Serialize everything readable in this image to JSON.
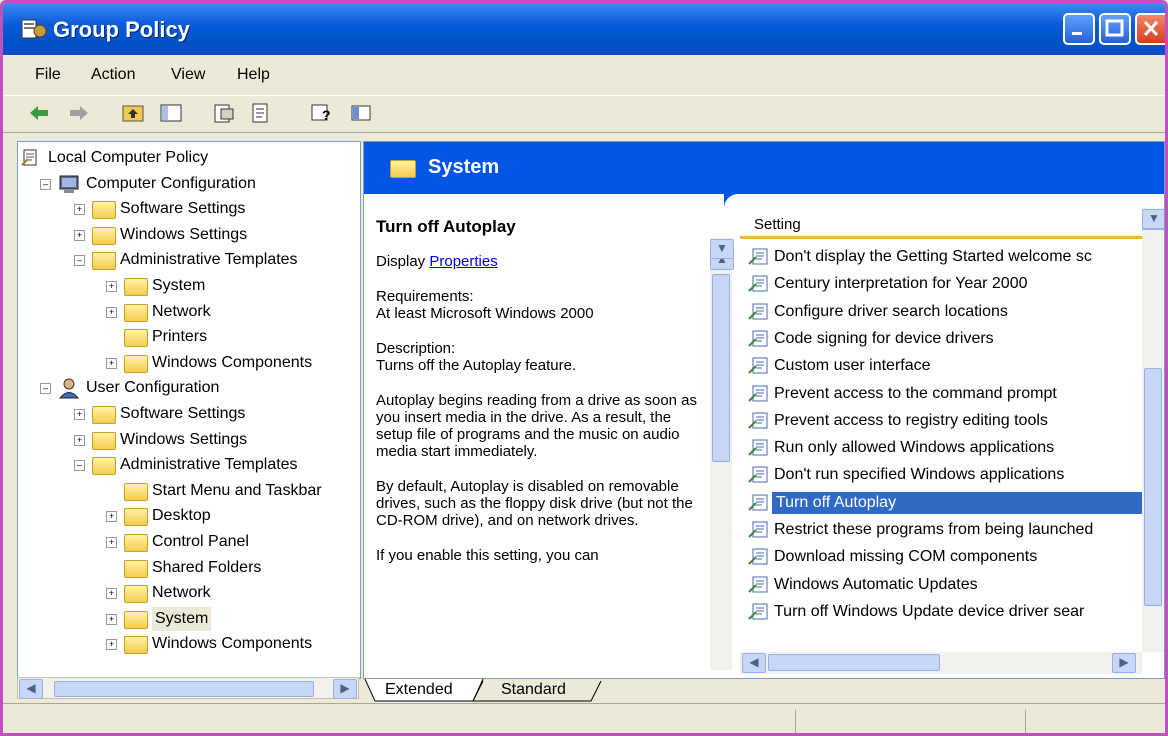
{
  "window": {
    "title": "Group Policy"
  },
  "menu": [
    "File",
    "Action",
    "View",
    "Help"
  ],
  "tree": [
    {
      "label": "Local Computer Policy",
      "level": 0,
      "expander": "",
      "icon": "policy-icon"
    },
    {
      "label": "Computer Configuration",
      "level": 1,
      "expander": "-",
      "icon": "computer-icon"
    },
    {
      "label": "Software Settings",
      "level": 2,
      "expander": "+",
      "icon": "folder-icon"
    },
    {
      "label": "Windows Settings",
      "level": 2,
      "expander": "+",
      "icon": "folder-icon"
    },
    {
      "label": "Administrative Templates",
      "level": 2,
      "expander": "-",
      "icon": "folder-icon"
    },
    {
      "label": "System",
      "level": 3,
      "expander": "+",
      "icon": "folder-icon"
    },
    {
      "label": "Network",
      "level": 3,
      "expander": "+",
      "icon": "folder-icon"
    },
    {
      "label": "Printers",
      "level": 3,
      "expander": "",
      "icon": "folder-icon"
    },
    {
      "label": "Windows Components",
      "level": 3,
      "expander": "+",
      "icon": "folder-icon"
    },
    {
      "label": "User Configuration",
      "level": 1,
      "expander": "-",
      "icon": "user-icon"
    },
    {
      "label": "Software Settings",
      "level": 2,
      "expander": "+",
      "icon": "folder-icon"
    },
    {
      "label": "Windows Settings",
      "level": 2,
      "expander": "+",
      "icon": "folder-icon"
    },
    {
      "label": "Administrative Templates",
      "level": 2,
      "expander": "-",
      "icon": "folder-icon"
    },
    {
      "label": "Start Menu and Taskbar",
      "level": 3,
      "expander": "",
      "icon": "folder-icon"
    },
    {
      "label": "Desktop",
      "level": 3,
      "expander": "+",
      "icon": "folder-icon"
    },
    {
      "label": "Control Panel",
      "level": 3,
      "expander": "+",
      "icon": "folder-icon"
    },
    {
      "label": "Shared Folders",
      "level": 3,
      "expander": "",
      "icon": "folder-icon"
    },
    {
      "label": "Network",
      "level": 3,
      "expander": "+",
      "icon": "folder-icon"
    },
    {
      "label": "System",
      "level": 3,
      "expander": "+",
      "icon": "folder-open-icon",
      "selected": true
    },
    {
      "label": "Windows Components",
      "level": 3,
      "expander": "+",
      "icon": "folder-icon"
    }
  ],
  "details": {
    "header": "System",
    "setting_title": "Turn off Autoplay",
    "display_label": "Display",
    "properties_link": "Properties",
    "requirements_label": "Requirements:",
    "requirements_value": "At least Microsoft Windows 2000",
    "description_label": "Description:",
    "description_value": "Turns off the Autoplay feature.",
    "para1": "Autoplay begins reading from a drive as soon as you insert media in the drive. As a result, the setup file of programs and the music on audio media start immediately.",
    "para2": "By default, Autoplay is disabled on removable drives, such as the floppy disk drive (but not the CD-ROM drive), and on network drives.",
    "para3": "If you enable this setting, you can"
  },
  "list": {
    "column_header": "Setting",
    "items": [
      {
        "label": "Don't display the Getting Started welcome sc",
        "selected": false
      },
      {
        "label": "Century interpretation for Year 2000",
        "selected": false
      },
      {
        "label": "Configure driver search locations",
        "selected": false
      },
      {
        "label": "Code signing for device drivers",
        "selected": false
      },
      {
        "label": "Custom user interface",
        "selected": false
      },
      {
        "label": "Prevent access to the command prompt",
        "selected": false
      },
      {
        "label": "Prevent access to registry editing tools",
        "selected": false
      },
      {
        "label": "Run only allowed Windows applications",
        "selected": false
      },
      {
        "label": "Don't run specified Windows applications",
        "selected": false
      },
      {
        "label": "Turn off Autoplay",
        "selected": true
      },
      {
        "label": "Restrict these programs from being launched",
        "selected": false
      },
      {
        "label": "Download missing COM components",
        "selected": false
      },
      {
        "label": "Windows Automatic Updates",
        "selected": false
      },
      {
        "label": "Turn off Windows Update device driver sear",
        "selected": false
      }
    ]
  },
  "tabs": [
    "Extended",
    "Standard"
  ],
  "colors": {
    "titlebar": "#0052cc",
    "header": "#0055e5",
    "selection": "#316ac5",
    "link": "#0000ee"
  }
}
